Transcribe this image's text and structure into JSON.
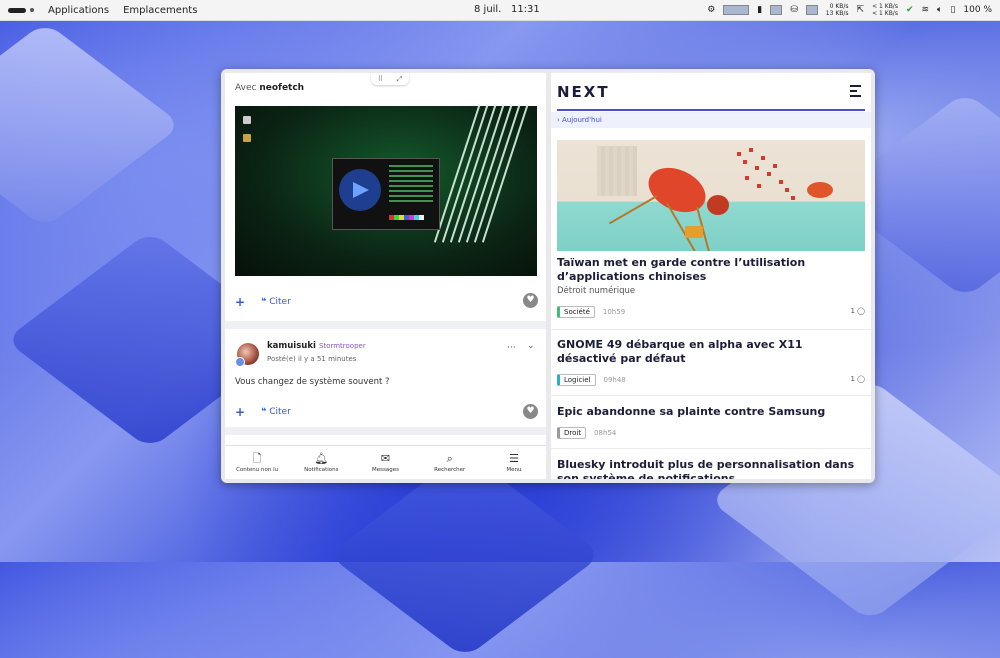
{
  "topbar": {
    "apps": "Applications",
    "places": "Emplacements",
    "date": "8 juil.",
    "time": "11:31",
    "net_down": "0 KB/s",
    "net_up": "13 KB/s",
    "net2_down": "< 1 KB/s",
    "net2_up": "< 1 KB/s",
    "battery": "100 %"
  },
  "left": {
    "avec_prefix": "Avec",
    "avec_app": "neofetch",
    "cite_label": "Citer",
    "post": {
      "author": "kamuisuki",
      "role": "Stormtrooper",
      "posted": "Posté(e) il y a 51 minutes",
      "body": "Vous changez de système souvent ?"
    },
    "nav": [
      {
        "label": "Contenu non lu",
        "icon": "document-icon"
      },
      {
        "label": "Notifications",
        "icon": "bell-icon"
      },
      {
        "label": "Messages",
        "icon": "envelope-icon"
      },
      {
        "label": "Rechercher",
        "icon": "search-icon"
      },
      {
        "label": "Menu",
        "icon": "menu-icon"
      }
    ]
  },
  "right": {
    "logo": "NEXT",
    "today": "Aujourd'hui",
    "articles": [
      {
        "title": "Taïwan met en garde contre l’utilisation d’applications chinoises",
        "subtitle": "Détroit numérique",
        "tag": "Société",
        "tag_color": "#3fbf6f",
        "time": "10h59",
        "comments": "1"
      },
      {
        "title": "GNOME 49 débarque en alpha avec X11 désactivé par défaut",
        "subtitle": "",
        "tag": "Logiciel",
        "tag_color": "#2bb0c9",
        "time": "09h48",
        "comments": "1"
      },
      {
        "title": "Epic abandonne sa plainte contre Samsung",
        "subtitle": "",
        "tag": "Droit",
        "tag_color": "#9a9a9a",
        "time": "08h54",
        "comments": ""
      },
      {
        "title": "Bluesky introduit plus de personnalisation dans son système de notifications",
        "subtitle": "",
        "tag": "",
        "tag_color": "",
        "time": "",
        "comments": ""
      }
    ]
  }
}
